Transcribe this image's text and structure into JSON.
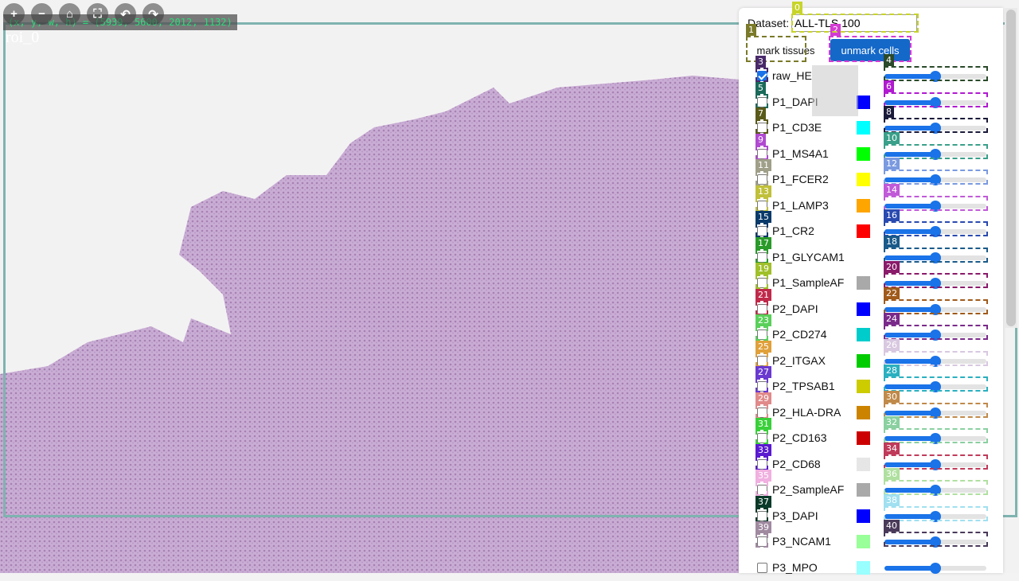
{
  "viewer": {
    "coords_text": "(x, y, w, h) = (5939, 5600, 2012, 1132)",
    "roi_label": "roi_0",
    "toolbar": [
      {
        "name": "zoom-in-icon",
        "glyph": "+"
      },
      {
        "name": "zoom-out-icon",
        "glyph": "−"
      },
      {
        "name": "home-icon",
        "glyph": "⌂"
      },
      {
        "name": "fullscreen-icon",
        "glyph": "⛶"
      },
      {
        "name": "rotate-left-icon",
        "glyph": "↶"
      },
      {
        "name": "rotate-right-icon",
        "glyph": "↷"
      }
    ]
  },
  "panel": {
    "dataset_label": "Dataset:",
    "dataset_value": "ALL-TLS 100",
    "mark_button": "mark tissues",
    "unmark_button": "unmark cells",
    "channels": [
      {
        "name": "raw_HE",
        "checked": true,
        "color": "",
        "level": 0.5
      },
      {
        "name": "P1_DAPI",
        "checked": false,
        "color": "#0000ff",
        "level": 0.5
      },
      {
        "name": "P1_CD3E",
        "checked": false,
        "color": "#00ffff",
        "level": 0.5
      },
      {
        "name": "P1_MS4A1",
        "checked": false,
        "color": "#00ff00",
        "level": 0.5
      },
      {
        "name": "P1_FCER2",
        "checked": false,
        "color": "#ffff00",
        "level": 0.5
      },
      {
        "name": "P1_LAMP3",
        "checked": false,
        "color": "#ffa500",
        "level": 0.5
      },
      {
        "name": "P1_CR2",
        "checked": false,
        "color": "#ff0000",
        "level": 0.5
      },
      {
        "name": "P1_GLYCAM1",
        "checked": false,
        "color": "#ffffff",
        "level": 0.5
      },
      {
        "name": "P1_SampleAF",
        "checked": false,
        "color": "#a9a9a9",
        "level": 0.5
      },
      {
        "name": "P2_DAPI",
        "checked": false,
        "color": "#0000ff",
        "level": 0.5
      },
      {
        "name": "P2_CD274",
        "checked": false,
        "color": "#00cccc",
        "level": 0.5
      },
      {
        "name": "P2_ITGAX",
        "checked": false,
        "color": "#00cc00",
        "level": 0.5
      },
      {
        "name": "P2_TPSAB1",
        "checked": false,
        "color": "#cccc00",
        "level": 0.5
      },
      {
        "name": "P2_HLA-DRA",
        "checked": false,
        "color": "#cc8400",
        "level": 0.5
      },
      {
        "name": "P2_CD163",
        "checked": false,
        "color": "#cc0000",
        "level": 0.5
      },
      {
        "name": "P2_CD68",
        "checked": false,
        "color": "#e6e6e6",
        "level": 0.5
      },
      {
        "name": "P2_SampleAF",
        "checked": false,
        "color": "#a9a9a9",
        "level": 0.5
      },
      {
        "name": "P3_DAPI",
        "checked": false,
        "color": "#0000ff",
        "level": 0.5
      },
      {
        "name": "P3_NCAM1",
        "checked": false,
        "color": "#99ff99",
        "level": 0.5
      },
      {
        "name": "P3_MPO",
        "checked": false,
        "color": "#99ffff",
        "level": 0.5
      }
    ]
  },
  "marks": [
    {
      "id": "0",
      "color": "#c8d42a"
    },
    {
      "id": "1",
      "color": "#7a7a2a"
    },
    {
      "id": "2",
      "color": "#d43ad4"
    },
    {
      "id": "3",
      "color": "#4a2a6a"
    },
    {
      "id": "4",
      "color": "#2a4a2a"
    },
    {
      "id": "5",
      "color": "#1a6a5a"
    },
    {
      "id": "6",
      "color": "#b01ad0"
    },
    {
      "id": "7",
      "color": "#5a5a1a"
    },
    {
      "id": "8",
      "color": "#1a1a3a"
    },
    {
      "id": "9",
      "color": "#b04ad0"
    },
    {
      "id": "10",
      "color": "#3aa08a"
    },
    {
      "id": "11",
      "color": "#a0a08a"
    },
    {
      "id": "12",
      "color": "#7a9ae0"
    },
    {
      "id": "13",
      "color": "#c0c03a"
    },
    {
      "id": "14",
      "color": "#c05ad8"
    },
    {
      "id": "15",
      "color": "#0a3a6a"
    },
    {
      "id": "16",
      "color": "#2a4ab0"
    },
    {
      "id": "17",
      "color": "#2a9a2a"
    },
    {
      "id": "18",
      "color": "#1a5a8a"
    },
    {
      "id": "19",
      "color": "#a0c02a"
    },
    {
      "id": "20",
      "color": "#8a1a6a"
    },
    {
      "id": "21",
      "color": "#c02a4a"
    },
    {
      "id": "22",
      "color": "#a05a1a"
    },
    {
      "id": "23",
      "color": "#5ad05a"
    },
    {
      "id": "24",
      "color": "#7a2a8a"
    },
    {
      "id": "25",
      "color": "#e0a03a"
    },
    {
      "id": "26",
      "color": "#d8c8e0"
    },
    {
      "id": "27",
      "color": "#6a3ad0"
    },
    {
      "id": "28",
      "color": "#2ab0c0"
    },
    {
      "id": "29",
      "color": "#e08a8a"
    },
    {
      "id": "30",
      "color": "#c08a4a"
    },
    {
      "id": "31",
      "color": "#3ad03a"
    },
    {
      "id": "32",
      "color": "#8ad0a0"
    },
    {
      "id": "33",
      "color": "#5a1ad0"
    },
    {
      "id": "34",
      "color": "#c03a5a"
    },
    {
      "id": "35",
      "color": "#f0b0e0"
    },
    {
      "id": "36",
      "color": "#b0e0a0"
    },
    {
      "id": "37",
      "color": "#0a3a2a"
    },
    {
      "id": "38",
      "color": "#a0e0f0"
    },
    {
      "id": "39",
      "color": "#a08aa0"
    },
    {
      "id": "40",
      "color": "#4a3a5a"
    }
  ]
}
